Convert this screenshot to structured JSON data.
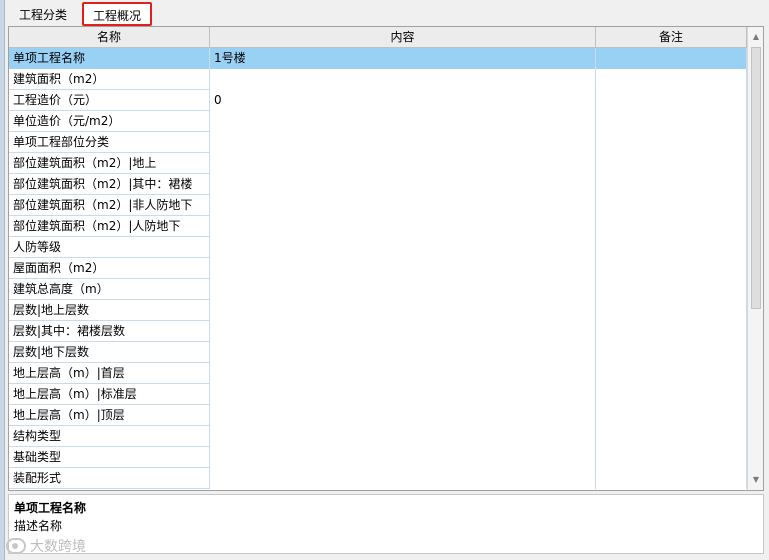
{
  "tabs": [
    "工程分类",
    "工程概况"
  ],
  "grid": {
    "columns": [
      "名称",
      "内容",
      "备注"
    ],
    "rows": [
      {
        "name": "单项工程名称",
        "content": "1号楼",
        "note": ""
      },
      {
        "name": "建筑面积（m2）",
        "content": "",
        "note": ""
      },
      {
        "name": "工程造价（元）",
        "content": "0",
        "note": ""
      },
      {
        "name": "单位造价（元/m2）",
        "content": "",
        "note": ""
      },
      {
        "name": "单项工程部位分类",
        "content": "",
        "note": ""
      },
      {
        "name": "部位建筑面积（m2）|地上",
        "content": "",
        "note": ""
      },
      {
        "name": "部位建筑面积（m2）|其中：裙楼",
        "content": "",
        "note": ""
      },
      {
        "name": "部位建筑面积（m2）|非人防地下",
        "content": "",
        "note": ""
      },
      {
        "name": "部位建筑面积（m2）|人防地下",
        "content": "",
        "note": ""
      },
      {
        "name": "人防等级",
        "content": "",
        "note": ""
      },
      {
        "name": "屋面面积（m2）",
        "content": "",
        "note": ""
      },
      {
        "name": "建筑总高度（m）",
        "content": "",
        "note": ""
      },
      {
        "name": "层数|地上层数",
        "content": "",
        "note": ""
      },
      {
        "name": "层数|其中：裙楼层数",
        "content": "",
        "note": ""
      },
      {
        "name": "层数|地下层数",
        "content": "",
        "note": ""
      },
      {
        "name": "地上层高（m）|首层",
        "content": "",
        "note": ""
      },
      {
        "name": "地上层高（m）|标准层",
        "content": "",
        "note": ""
      },
      {
        "name": "地上层高（m）|顶层",
        "content": "",
        "note": ""
      },
      {
        "name": "结构类型",
        "content": "",
        "note": ""
      },
      {
        "name": "基础类型",
        "content": "",
        "note": ""
      },
      {
        "name": "装配形式",
        "content": "",
        "note": ""
      }
    ],
    "selected_index": 0
  },
  "description": {
    "title": "单项工程名称",
    "text": "描述名称"
  },
  "watermark": {
    "text": "大数跨境"
  },
  "colors": {
    "selected_row": "#99d1f5",
    "active_tab_border": "#e0201b"
  }
}
